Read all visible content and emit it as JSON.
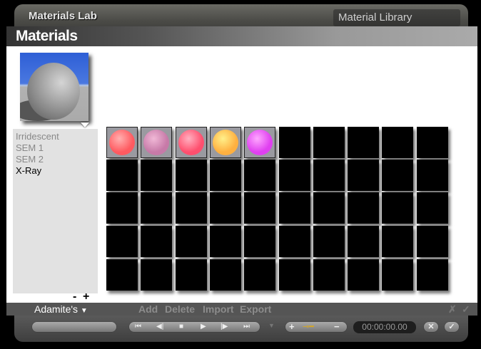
{
  "app": {
    "title": "Materials Lab",
    "library": "Material Library"
  },
  "header": {
    "title": "Materials"
  },
  "list": {
    "items": [
      {
        "label": "Irridescent",
        "selected": false
      },
      {
        "label": "SEM 1",
        "selected": false
      },
      {
        "label": "SEM 2",
        "selected": false
      },
      {
        "label": "X-Ray",
        "selected": true
      }
    ],
    "minus": "-",
    "plus": "+"
  },
  "grid": {
    "columns": 10,
    "rows": 5,
    "swatches": [
      {
        "color": "#ff5a60",
        "hi": "#ffb0b0"
      },
      {
        "color": "#c77aa8",
        "hi": "#f0b8d6"
      },
      {
        "color": "#ff4f6e",
        "hi": "#ffb0c0"
      },
      {
        "color": "#ffb040",
        "hi": "#fff08a"
      },
      {
        "color": "#e040f0",
        "hi": "#ffa8ff"
      }
    ]
  },
  "bottom": {
    "set": "Adamite's",
    "add": "Add",
    "delete": "Delete",
    "import": "Import",
    "export": "Export",
    "cancel": "✗",
    "ok": "✓"
  },
  "controls": {
    "time": "00:00:00.00",
    "cancel": "✕",
    "ok": "✓",
    "plus": "+",
    "minus": "−"
  }
}
